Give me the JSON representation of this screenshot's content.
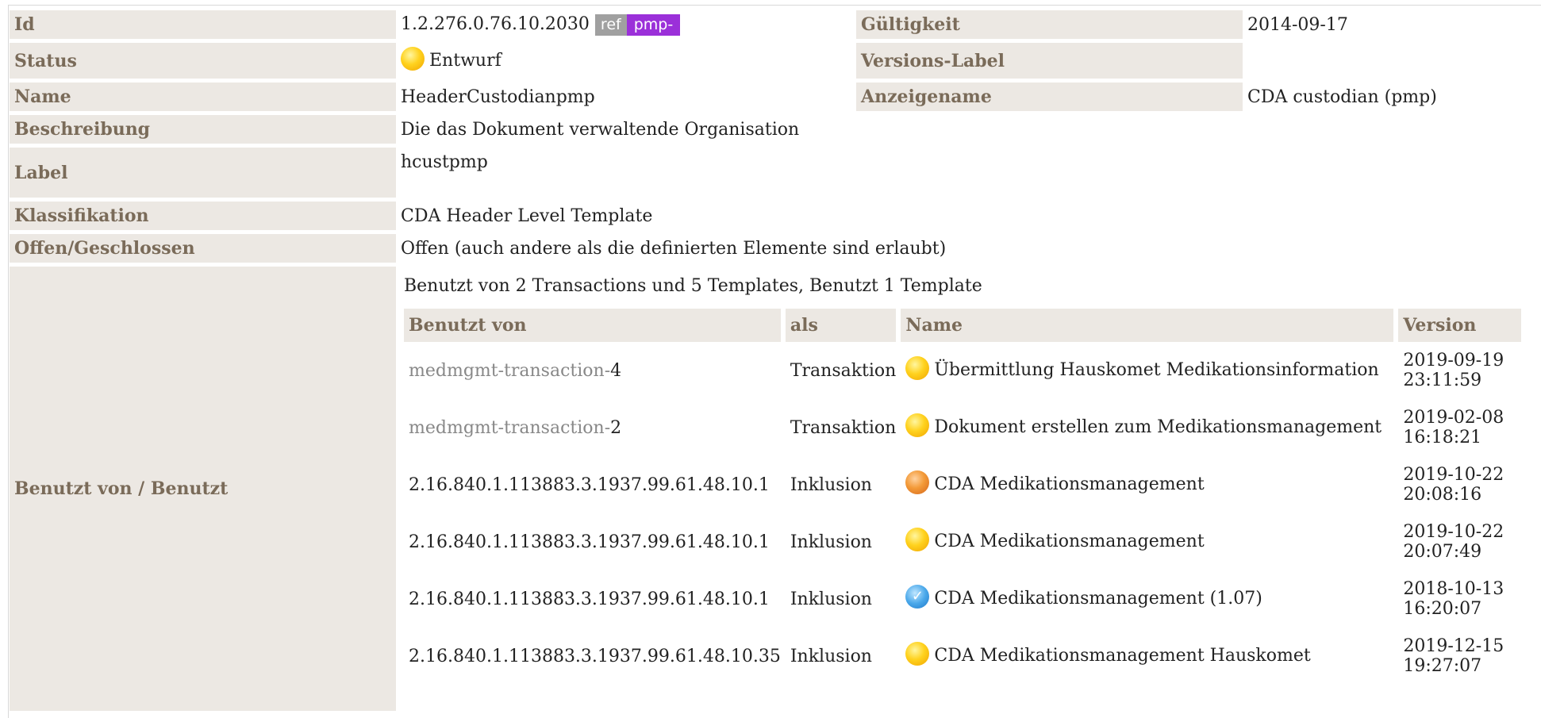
{
  "rows": {
    "id": {
      "label": "Id",
      "value": "1.2.276.0.76.10.2030",
      "ref": "ref",
      "pmp": "pmp-"
    },
    "gueltigkeit": {
      "label": "Gültigkeit",
      "value": "2014-09-17"
    },
    "status": {
      "label": "Status",
      "value": "Entwurf",
      "icon": "draft-status-icon"
    },
    "versions_label": {
      "label": "Versions-Label",
      "value": ""
    },
    "name": {
      "label": "Name",
      "value": "HeaderCustodianpmp"
    },
    "anzeigename": {
      "label": "Anzeigename",
      "value": "CDA custodian (pmp)"
    },
    "beschreibung": {
      "label": "Beschreibung",
      "value": "Die das Dokument verwaltende Organisation"
    },
    "label": {
      "label": "Label",
      "value": "hcustpmp"
    },
    "klassifikation": {
      "label": "Klassifikation",
      "value": "CDA Header Level Template"
    },
    "offen": {
      "label": "Offen/Geschlossen",
      "value": "Offen (auch andere als die definierten Elemente sind erlaubt)"
    },
    "benutzt": {
      "label": "Benutzt von / Benutzt"
    }
  },
  "usage": {
    "caption": "Benutzt von 2 Transactions und 5 Templates, Benutzt 1 Template",
    "headers": {
      "by": "Benutzt von",
      "as": "als",
      "name": "Name",
      "version": "Version"
    },
    "items": [
      {
        "prefix": "medmgmt-transaction-",
        "num": "4",
        "as": "Transaktion",
        "status": "yellow",
        "name": "Übermittlung Hauskomet Medikationsinformation",
        "date": "2019-09-19",
        "time": "23:11:59"
      },
      {
        "prefix": "medmgmt-transaction-",
        "num": "2",
        "as": "Transaktion",
        "status": "yellow",
        "name": "Dokument erstellen zum Medikationsmanagement",
        "date": "2019-02-08",
        "time": "16:18:21"
      },
      {
        "id": "2.16.840.1.113883.3.1937.99.61.48.10.1",
        "as": "Inklusion",
        "status": "orange",
        "name": "CDA Medikationsmanagement",
        "date": "2019-10-22",
        "time": "20:08:16"
      },
      {
        "id": "2.16.840.1.113883.3.1937.99.61.48.10.1",
        "as": "Inklusion",
        "status": "yellow",
        "name": "CDA Medikationsmanagement",
        "date": "2019-10-22",
        "time": "20:07:49"
      },
      {
        "id": "2.16.840.1.113883.3.1937.99.61.48.10.1",
        "as": "Inklusion",
        "status": "blue",
        "name": "CDA Medikationsmanagement (1.07)",
        "date": "2018-10-13",
        "time": "16:20:07"
      },
      {
        "id": "2.16.840.1.113883.3.1937.99.61.48.10.35",
        "as": "Inklusion",
        "status": "yellow",
        "name": "CDA Medikationsmanagement Hauskomet",
        "date": "2019-12-15",
        "time": "19:27:07"
      }
    ]
  }
}
